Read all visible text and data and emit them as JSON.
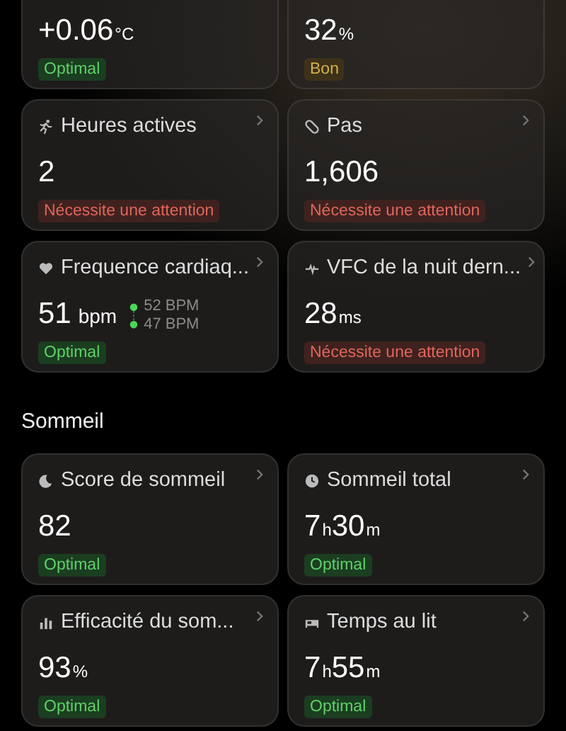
{
  "sections": [
    {
      "cards": [
        {
          "value": [
            {
              "n": "+0.06",
              "u": "°C"
            }
          ],
          "status": {
            "label": "Optimal",
            "kind": "optimal"
          }
        },
        {
          "value": [
            {
              "n": "32",
              "u": "%"
            }
          ],
          "status": {
            "label": "Bon",
            "kind": "good"
          }
        },
        {
          "title": "Heures actives",
          "value": [
            {
              "n": "2"
            }
          ],
          "status": {
            "label": "Nécessite une attention",
            "kind": "attention"
          }
        },
        {
          "title": "Pas",
          "value": [
            {
              "n": "1,606"
            }
          ],
          "status": {
            "label": "Nécessite une attention",
            "kind": "attention"
          }
        },
        {
          "title": "Frequence cardiaq...",
          "value": [
            {
              "n": "51",
              "u": "bpm"
            }
          ],
          "range": [
            "52 BPM",
            "47 BPM"
          ],
          "status": {
            "label": "Optimal",
            "kind": "optimal"
          }
        },
        {
          "title": "VFC de la nuit dern...",
          "value": [
            {
              "n": "28",
              "u": "ms"
            }
          ],
          "status": {
            "label": "Nécessite une attention",
            "kind": "attention"
          }
        }
      ]
    },
    {
      "title": "Sommeil",
      "cards": [
        {
          "title": "Score de sommeil",
          "value": [
            {
              "n": "82"
            }
          ],
          "status": {
            "label": "Optimal",
            "kind": "optimal"
          }
        },
        {
          "title": "Sommeil total",
          "value": [
            {
              "n": "7",
              "u": "h"
            },
            {
              "n": "30",
              "u": "m"
            }
          ],
          "status": {
            "label": "Optimal",
            "kind": "optimal"
          }
        },
        {
          "title": "Efficacité du som...",
          "value": [
            {
              "n": "93",
              "u": "%"
            }
          ],
          "status": {
            "label": "Optimal",
            "kind": "optimal"
          }
        },
        {
          "title": "Temps au lit",
          "value": [
            {
              "n": "7",
              "u": "h"
            },
            {
              "n": "55",
              "u": "m"
            }
          ],
          "status": {
            "label": "Optimal",
            "kind": "optimal"
          }
        }
      ]
    }
  ]
}
